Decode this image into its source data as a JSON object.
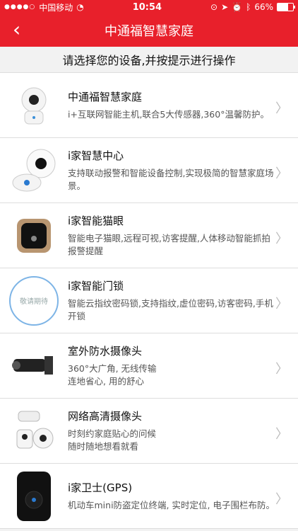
{
  "status": {
    "carrier": "中国移动",
    "time": "10:54",
    "battery": "66%"
  },
  "nav": {
    "title": "中通福智慧家庭"
  },
  "subheader": "请选择您的设备,并按提示进行操作",
  "devices": [
    {
      "title": "中通福智慧家庭",
      "desc": "i+互联网智能主机,联合5大传感器,360°温馨防护。",
      "icon": "robot-camera-icon"
    },
    {
      "title": "i家智慧中心",
      "desc": "支持联动报警和智能设备控制,实现极简的智慧家庭场景。",
      "icon": "smart-hub-icon"
    },
    {
      "title": "i家智能猫眼",
      "desc": "智能电子猫眼,远程可视,访客提醒,人体移动智能抓拍报警提醒",
      "icon": "peephole-icon"
    },
    {
      "title": "i家智能门锁",
      "desc": "智能云指纹密码锁,支持指纹,虚位密码,访客密码,手机开锁",
      "icon": "coming-soon-badge",
      "badge": "敬请期待"
    },
    {
      "title": "室外防水摄像头",
      "desc": "360°大广角, 无线传输\n连地省心, 用的舒心",
      "icon": "outdoor-camera-icon"
    },
    {
      "title": "网络高清摄像头",
      "desc": "时刻约家庭贴心的问候\n随时随地想看就看",
      "icon": "hd-camera-icon"
    },
    {
      "title": "i家卫士(GPS)",
      "desc": "机动车mini防盗定位终端, 实时定位, 电子围栏布防。",
      "icon": "gps-tracker-icon"
    }
  ]
}
